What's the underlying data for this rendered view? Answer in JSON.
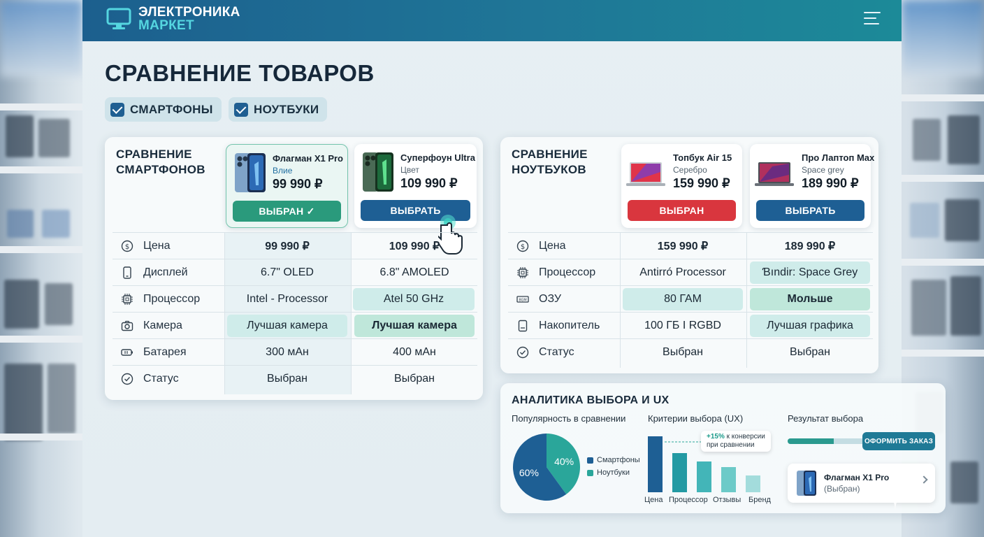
{
  "app": {
    "logo_line1": "ЭЛЕКТРОНИКА",
    "logo_line2": "МАРКЕТ"
  },
  "page": {
    "title": "СРАВНЕНИЕ ТОВАРОВ"
  },
  "filters": [
    {
      "label": "СМАРТФОНЫ",
      "checked": true
    },
    {
      "label": "НОУТБУКИ",
      "checked": true
    }
  ],
  "smartphones": {
    "title_line1": "СРАВНЕНИЕ",
    "title_line2": "СМАРТФОНОВ",
    "products": [
      {
        "name": "Флагман X1 Pro",
        "sub": "Влие",
        "price": "99 990 ₽",
        "button": "ВЫБРАН ✓",
        "state": "selected"
      },
      {
        "name": "Суперфоун Ultra",
        "sub": "Цвет",
        "price": "109 990 ₽",
        "button": "ВЫБРАТЬ",
        "state": "default"
      }
    ],
    "rows": [
      {
        "icon": "price-icon",
        "label": "Цена",
        "values": [
          "99 990 ₽",
          "109 990 ₽"
        ]
      },
      {
        "icon": "display-icon",
        "label": "Дисплей",
        "values": [
          "6.7\" OLED",
          "6.8\" AMOLED"
        ]
      },
      {
        "icon": "cpu-icon",
        "label": "Процессор",
        "values": [
          "Intel - Processor",
          " Atel 50 GHz"
        ]
      },
      {
        "icon": "camera-icon",
        "label": "Камера",
        "values": [
          "Лучшая камера",
          "Лучшая камера"
        ]
      },
      {
        "icon": "battery-icon",
        "label": "Батарея",
        "values": [
          "300 мАн",
          "400 мАн"
        ]
      },
      {
        "icon": "status-icon",
        "label": "Статус",
        "values": [
          "Выбран",
          "Выбран"
        ]
      }
    ]
  },
  "laptops": {
    "title_line1": "СРАВНЕНИЕ",
    "title_line2": "НОУТБУКОВ",
    "products": [
      {
        "name": "Топбук Air 15",
        "sub": "Серебро",
        "price": "159 990 ₽",
        "button": "ВЫБРАН",
        "state": "selected"
      },
      {
        "name": "Про Лаптоп Max",
        "sub": "Space grey",
        "price": "189 990 ₽",
        "button": "ВЫБРАТЬ",
        "state": "default"
      }
    ],
    "rows": [
      {
        "icon": "price-icon",
        "label": "Цена",
        "values": [
          "159 990 ₽",
          "189 990 ₽"
        ]
      },
      {
        "icon": "cpu-icon",
        "label": "Процессор",
        "values": [
          "Antirró Processor",
          "Ɓındir: Space Grey"
        ]
      },
      {
        "icon": "ram-icon",
        "label": "ОЗУ",
        "values": [
          "80 ГАМ",
          "Мольше"
        ]
      },
      {
        "icon": "storage-icon",
        "label": "Накопитель",
        "values": [
          "100 ГБ I RGBD",
          "Лучшая графика"
        ]
      },
      {
        "icon": "status-icon",
        "label": "Статус",
        "values": [
          "Выбран",
          "Выбран"
        ]
      }
    ]
  },
  "analytics": {
    "title": "АНАЛИТИКА ВЫБОРА И UX",
    "popularity_title": "Популярность в сравнении",
    "criteria_title": "Критерии выбора (UX)",
    "result_title": "Результат выбора",
    "tooltip_accent": "+15%",
    "tooltip_line1": " к конверсии",
    "tooltip_line2": "при сравнении",
    "order_button": "ОФОРМИТЬ ЗАКАЗ",
    "progress": 0.6,
    "result_name": "Флагман X1 Pro",
    "result_status": "(Выбран)"
  },
  "colors": {
    "dark_blue": "#1e5f94",
    "teal": "#2a9a8f",
    "selected_green": "#2a9a7c",
    "selected_red": "#d9363e"
  },
  "chart_data": [
    {
      "type": "pie",
      "title": "Популярность в сравнении",
      "labels": [
        "Смартфоны",
        "Ноутбуки"
      ],
      "values": [
        60,
        40
      ],
      "value_labels": [
        "60%",
        "40%"
      ],
      "colors": [
        "#1e5f94",
        "#2aa69a"
      ],
      "legend": "right"
    },
    {
      "type": "bar",
      "title": "Критерии выбора (UX)",
      "categories": [
        "Цена",
        "Процессор",
        "Отзывы",
        "Бренд"
      ],
      "values": [
        100,
        70,
        55,
        45,
        30
      ],
      "bar_colors": [
        "#1e5f94",
        "#239aa3",
        "#43b5b8",
        "#6ccac8",
        "#a3dcdc"
      ],
      "ylim": [
        0,
        100
      ]
    }
  ]
}
